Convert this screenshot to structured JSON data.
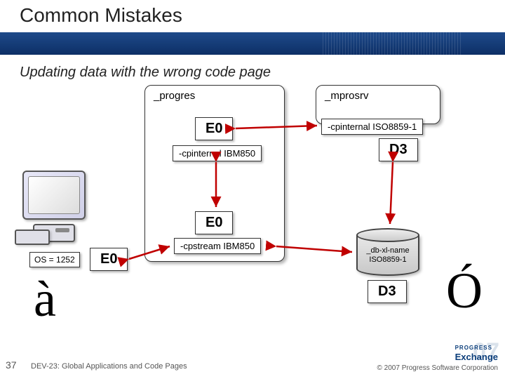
{
  "title": "Common Mistakes",
  "subtitle": "Updating data with the wrong code page",
  "left_box": {
    "title": "_progres"
  },
  "right_box": {
    "title": "_mprosrv"
  },
  "codes": {
    "e0_top": "E0",
    "e0_mid": "E0",
    "e0_left": "E0",
    "d3_top": "D3",
    "d3_bottom": "D3"
  },
  "params": {
    "cpinternal_ibm": "-cpinternal IBM850",
    "cpstream_ibm": "-cpstream IBM850",
    "cpinternal_iso": "-cpinternal ISO8859-1"
  },
  "os_label": "OS = 1252",
  "db_label_line1": "_db-xl-name",
  "db_label_line2": "ISO8859-1",
  "char_left": "à",
  "char_right": "Ó",
  "footer": {
    "slide": "37",
    "session": "DEV-23: Global Applications and Code Pages",
    "copyright": "© 2007 Progress Software Corporation",
    "brand1": "PROGRESS",
    "brand2": "Exchange"
  }
}
